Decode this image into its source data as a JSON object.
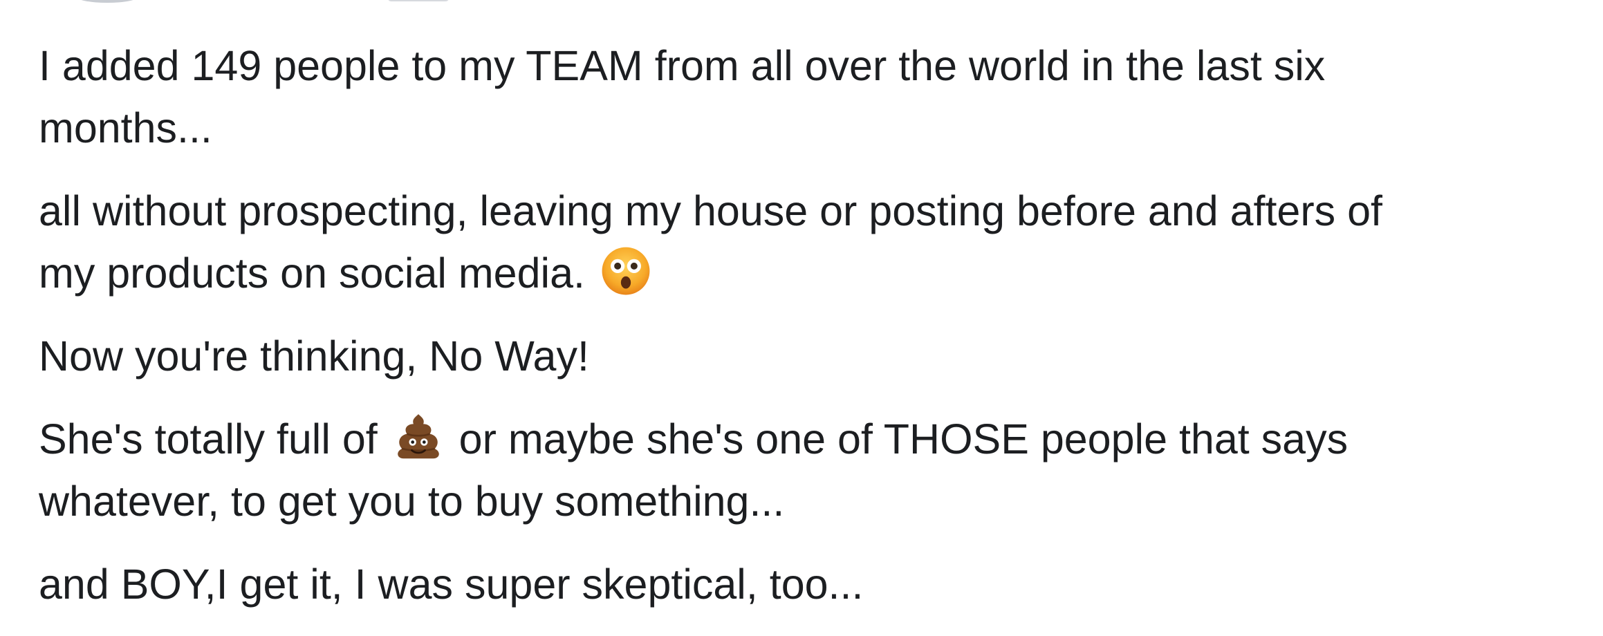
{
  "post": {
    "paragraphs": [
      {
        "lines": [
          "I added 149 people to my TEAM from all over the world in the last six",
          "months..."
        ]
      },
      {
        "lines": [
          "all without prospecting, leaving my house or posting before and afters of"
        ],
        "last_line_text": "my products on social media.",
        "trailing_emoji": "astonished-face-emoji"
      },
      {
        "lines": [
          "Now you're thinking, No Way!"
        ]
      },
      {
        "first_line_before": "She's totally full of",
        "inline_emoji": "pile-of-poo-emoji",
        "first_line_after": "or maybe she's one of THOSE people that says",
        "lines": [
          "whatever, to get you to buy something..."
        ]
      },
      {
        "lines": [
          "and BOY,I get it, I was super skeptical, too..."
        ]
      }
    ]
  },
  "colors": {
    "text": "#1c1e21",
    "background": "#ffffff"
  }
}
